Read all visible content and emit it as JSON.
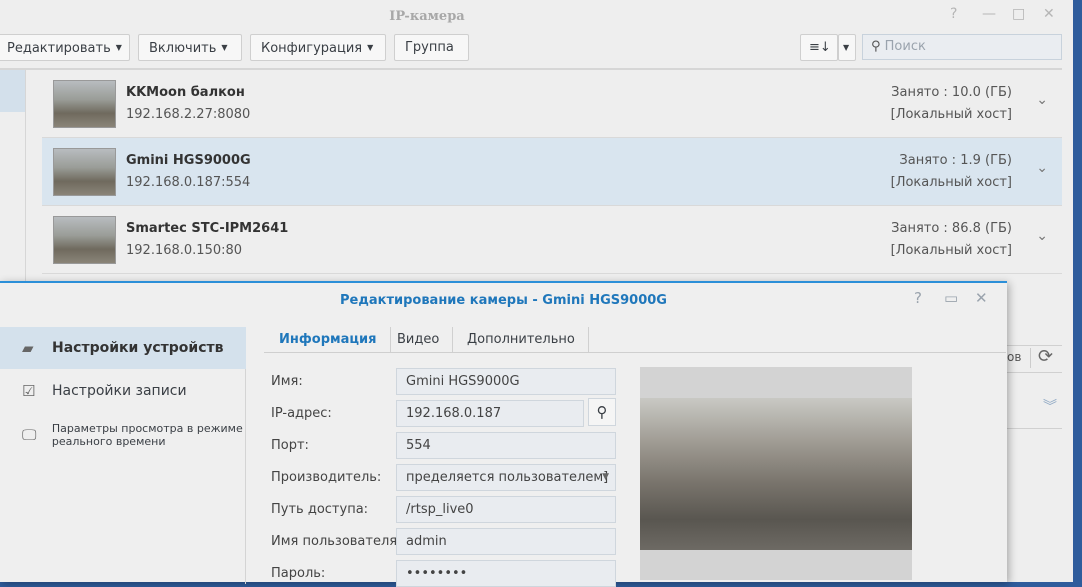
{
  "window": {
    "title": "IP-камера",
    "controls": [
      "?",
      "—",
      "□",
      "✕"
    ]
  },
  "toolbar": {
    "edit": "Редактировать",
    "enable": "Включить",
    "config": "Конфигурация",
    "group": "Группа",
    "sort_icon": "≡↓",
    "search_placeholder": "Поиск"
  },
  "cameras": [
    {
      "name": "KKMoon балкон",
      "ip": "192.168.2.27:8080",
      "used": "Занято : 10.0 (ГБ)",
      "host": "[Локальный хост]"
    },
    {
      "name": "Gmini HGS9000G",
      "ip": "192.168.0.187:554",
      "used": "Занято : 1.9 (ГБ)",
      "host": "[Локальный хост]"
    },
    {
      "name": "Smartec STC-IPM2641",
      "ip": "192.168.0.150:80",
      "used": "Занято : 86.8 (ГБ)",
      "host": "[Локальный хост]"
    }
  ],
  "background": {
    "partial_text": "ов"
  },
  "dialog": {
    "title": "Редактирование камеры - Gmini HGS9000G",
    "sidebar": [
      "Настройки устройств",
      "Настройки записи",
      "Параметры просмотра в режиме реального времени"
    ],
    "tabs": [
      "Информация",
      "Видео",
      "Дополнительно"
    ],
    "fields": [
      {
        "label": "Имя:",
        "value": "Gmini HGS9000G"
      },
      {
        "label": "IP-адрес:",
        "value": "192.168.0.187"
      },
      {
        "label": "Порт:",
        "value": "554"
      },
      {
        "label": "Производитель:",
        "value": "пределяется пользователем]"
      },
      {
        "label": "Путь доступа:",
        "value": "/rtsp_live0"
      },
      {
        "label": "Имя пользователя:",
        "value": "admin"
      },
      {
        "label": "Пароль:",
        "value": "••••••••"
      }
    ]
  }
}
